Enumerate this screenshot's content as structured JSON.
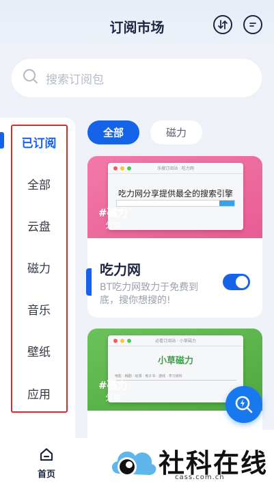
{
  "header": {
    "title": "订阅市场"
  },
  "search": {
    "placeholder": "搜索订阅包"
  },
  "sidebar": {
    "items": [
      {
        "label": "已订阅"
      },
      {
        "label": "全部"
      },
      {
        "label": "云盘"
      },
      {
        "label": "磁力"
      },
      {
        "label": "音乐"
      },
      {
        "label": "壁纸"
      },
      {
        "label": "应用"
      }
    ]
  },
  "filters": [
    {
      "label": "全部"
    },
    {
      "label": "磁力"
    }
  ],
  "cards": [
    {
      "browser_title": "乐搜订阅站 · 吃力网",
      "headline": "吃力网分享提供最全的搜索引擎",
      "overlay_name": "#磁力",
      "overlay_sub": "分类",
      "name": "吃力网",
      "desc": "BT吃力网致力于免费到底，搜你想搜的!",
      "subscribed": true
    },
    {
      "browser_title": "必看订阅站 · 小草磁力",
      "headline": "小草磁力",
      "search_hint": "电影 · 韩剧 · 动漫 · 电子书 · 游戏 · 学习资料",
      "overlay_name": "#磁力",
      "overlay_sub": "分类"
    }
  ],
  "tabbar": {
    "home": "首页"
  },
  "watermark": {
    "text": "社科在线",
    "url": "cass.com.cn"
  },
  "colors": {
    "accent": "#1463e8",
    "highlight_box": "#e0262a",
    "card1_banner": "#e85c93",
    "card2_banner": "#4ea83d"
  }
}
